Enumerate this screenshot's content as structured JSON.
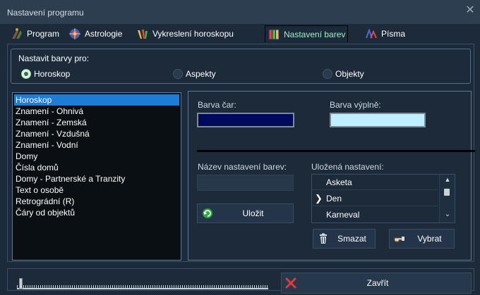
{
  "window": {
    "title": "Nastavení programu"
  },
  "tabs": [
    {
      "label": "Program",
      "icon": "program-icon"
    },
    {
      "label": "Astrologie",
      "icon": "astrology-icon"
    },
    {
      "label": "Vykreslení horoskopu",
      "icon": "paint-icon"
    },
    {
      "label": "Nastavení barev",
      "icon": "color-settings-icon",
      "active": true
    },
    {
      "label": "Písma",
      "icon": "fonts-icon"
    }
  ],
  "color_target": {
    "legend": "Nastavit barvy pro:",
    "options": [
      {
        "label": "Horoskop",
        "selected": true
      },
      {
        "label": "Aspekty",
        "selected": false
      },
      {
        "label": "Objekty",
        "selected": false
      }
    ]
  },
  "items": {
    "selected_index": 0,
    "list": [
      "Horoskop",
      "Znamení - Ohnivá",
      "Znamení - Zemská",
      "Znamení - Vzdušná",
      "Znamení - Vodní",
      "Domy",
      "Čísla domů",
      "Domy - Partnerské a Tranzity",
      "Text o osobě",
      "Retrográdní (R)",
      "Čáry od objektů"
    ]
  },
  "colors": {
    "line_label": "Barva čar:",
    "line_color": "#000a5c",
    "fill_label": "Barva výplně:",
    "fill_color": "#bfeeff",
    "accent": "#1e7bd6"
  },
  "save": {
    "name_label": "Název nastavení barev:",
    "name_value": "",
    "button": "Uložit"
  },
  "saved": {
    "label": "Uložená nastavení:",
    "items": [
      "Asketa",
      "Den",
      "Karneval"
    ],
    "current": "Den",
    "delete_button": "Smazat",
    "select_button": "Vybrat"
  },
  "footer": {
    "progress": 0.0,
    "close_button": "Zavřít"
  }
}
